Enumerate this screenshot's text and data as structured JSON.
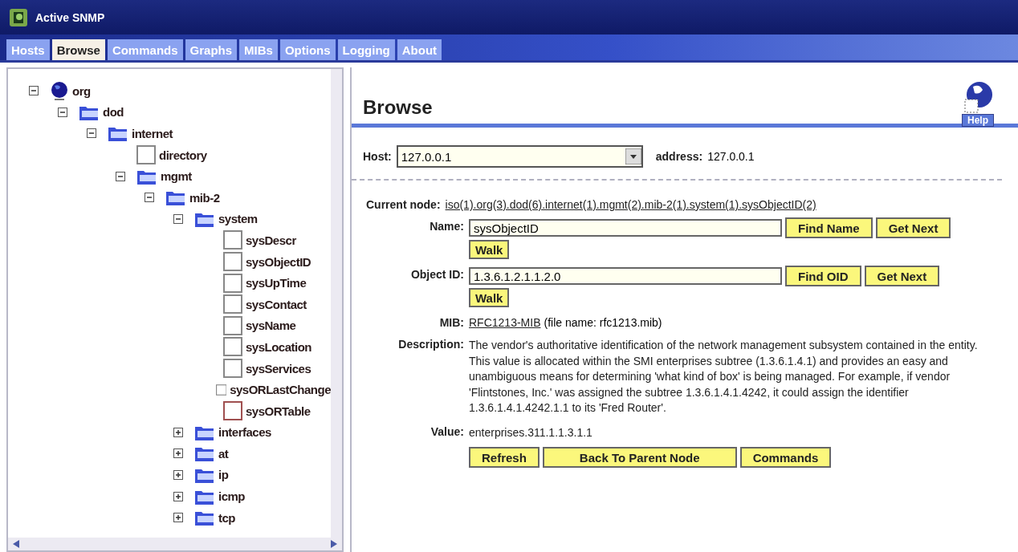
{
  "window": {
    "title": "Active SNMP"
  },
  "tabs": [
    {
      "label": "Hosts",
      "selected": false
    },
    {
      "label": "Browse",
      "selected": true
    },
    {
      "label": "Commands",
      "selected": false
    },
    {
      "label": "Graphs",
      "selected": false
    },
    {
      "label": "MIBs",
      "selected": false
    },
    {
      "label": "Options",
      "selected": false
    },
    {
      "label": "Logging",
      "selected": false
    },
    {
      "label": "About",
      "selected": false
    }
  ],
  "tree": [
    {
      "label": "org",
      "kind": "globe",
      "expanded": true,
      "children": [
        {
          "label": "dod",
          "kind": "folder",
          "expanded": true,
          "children": [
            {
              "label": "internet",
              "kind": "folder",
              "expanded": true,
              "children": [
                {
                  "label": "directory",
                  "kind": "leaf"
                },
                {
                  "label": "mgmt",
                  "kind": "folder",
                  "expanded": true,
                  "children": [
                    {
                      "label": "mib-2",
                      "kind": "folder",
                      "expanded": true,
                      "children": [
                        {
                          "label": "system",
                          "kind": "folder",
                          "expanded": true,
                          "children": [
                            {
                              "label": "sysDescr",
                              "kind": "leaf"
                            },
                            {
                              "label": "sysObjectID",
                              "kind": "leaf"
                            },
                            {
                              "label": "sysUpTime",
                              "kind": "leaf"
                            },
                            {
                              "label": "sysContact",
                              "kind": "leaf"
                            },
                            {
                              "label": "sysName",
                              "kind": "leaf"
                            },
                            {
                              "label": "sysLocation",
                              "kind": "leaf"
                            },
                            {
                              "label": "sysServices",
                              "kind": "leaf"
                            },
                            {
                              "label": "sysORLastChange",
                              "kind": "leaf"
                            },
                            {
                              "label": "sysORTable",
                              "kind": "table"
                            }
                          ]
                        },
                        {
                          "label": "interfaces",
                          "kind": "folder",
                          "expanded": false
                        },
                        {
                          "label": "at",
                          "kind": "folder",
                          "expanded": false
                        },
                        {
                          "label": "ip",
                          "kind": "folder",
                          "expanded": false
                        },
                        {
                          "label": "icmp",
                          "kind": "folder",
                          "expanded": false
                        },
                        {
                          "label": "tcp",
                          "kind": "folder",
                          "expanded": false
                        }
                      ]
                    }
                  ]
                }
              ]
            }
          ]
        }
      ]
    }
  ],
  "browse": {
    "title": "Browse",
    "help": "Help",
    "host": {
      "label": "Host:",
      "value": "127.0.0.1",
      "address_label": "address:",
      "address": "127.0.0.1"
    },
    "current_node": {
      "label": "Current node:",
      "value": "iso(1).org(3).dod(6).internet(1).mgmt(2).mib-2(1).system(1).sysObjectID(2)"
    },
    "name": {
      "label": "Name:",
      "value": "sysObjectID",
      "buttons": [
        "Find Name",
        "Get Next"
      ],
      "walk": "Walk"
    },
    "object_id": {
      "label": "Object ID:",
      "value": "1.3.6.1.2.1.1.2.0",
      "buttons": [
        "Find OID",
        "Get Next"
      ],
      "walk": "Walk"
    },
    "mib": {
      "label": "MIB:",
      "link": "RFC1213-MIB",
      "text": "(file name: rfc1213.mib)"
    },
    "description": {
      "label": "Description:",
      "text": "The vendor's authoritative identification of the network management subsystem contained in the entity. This value is allocated within the SMI enterprises subtree (1.3.6.1.4.1) and provides an easy and unambiguous means for determining 'what kind of box' is being managed. For example, if vendor 'Flintstones, Inc.' was assigned the subtree 1.3.6.1.4.1.4242, it could assign the identifier 1.3.6.1.4.1.4242.1.1 to its 'Fred Router'."
    },
    "value": {
      "label": "Value:",
      "text": "enterprises.311.1.1.3.1.1"
    },
    "buttons": [
      "Refresh",
      "Back To Parent Node",
      "Commands"
    ]
  }
}
